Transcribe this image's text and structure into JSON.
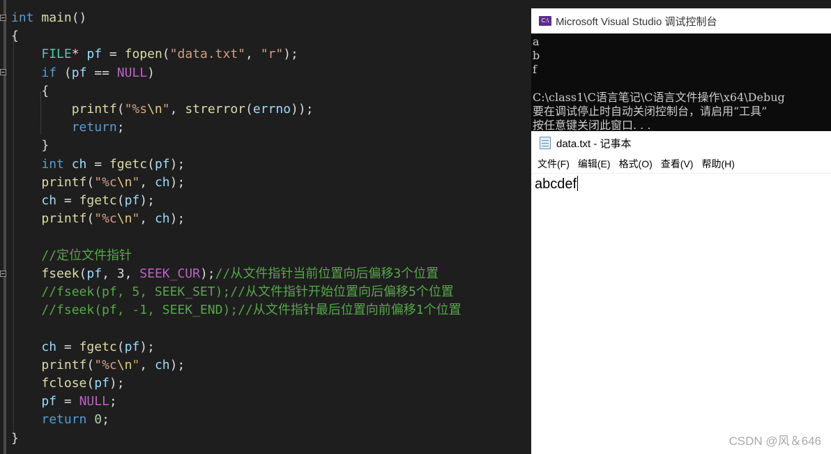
{
  "editor": {
    "lines": [
      [
        {
          "t": "int",
          "c": "kw"
        },
        {
          "t": " ",
          "c": "pl"
        },
        {
          "t": "main",
          "c": "fn"
        },
        {
          "t": "()",
          "c": "pl"
        }
      ],
      [
        {
          "t": "{",
          "c": "pl"
        }
      ],
      [
        {
          "t": "    ",
          "c": "pl"
        },
        {
          "t": "FILE",
          "c": "ty"
        },
        {
          "t": "* ",
          "c": "pl"
        },
        {
          "t": "pf",
          "c": "var"
        },
        {
          "t": " = ",
          "c": "pl"
        },
        {
          "t": "fopen",
          "c": "fn"
        },
        {
          "t": "(",
          "c": "pl"
        },
        {
          "t": "\"data.txt\"",
          "c": "st"
        },
        {
          "t": ", ",
          "c": "pl"
        },
        {
          "t": "\"r\"",
          "c": "st"
        },
        {
          "t": ");",
          "c": "pl"
        }
      ],
      [
        {
          "t": "    ",
          "c": "pl"
        },
        {
          "t": "if",
          "c": "kw"
        },
        {
          "t": " (",
          "c": "pl"
        },
        {
          "t": "pf",
          "c": "var"
        },
        {
          "t": " == ",
          "c": "pl"
        },
        {
          "t": "NULL",
          "c": "mac"
        },
        {
          "t": ")",
          "c": "pl"
        }
      ],
      [
        {
          "t": "    {",
          "c": "pl"
        }
      ],
      [
        {
          "t": "        ",
          "c": "pl"
        },
        {
          "t": "printf",
          "c": "fn"
        },
        {
          "t": "(",
          "c": "pl"
        },
        {
          "t": "\"%s",
          "c": "st"
        },
        {
          "t": "\\n",
          "c": "es"
        },
        {
          "t": "\"",
          "c": "st"
        },
        {
          "t": ", ",
          "c": "pl"
        },
        {
          "t": "strerror",
          "c": "fn"
        },
        {
          "t": "(",
          "c": "pl"
        },
        {
          "t": "errno",
          "c": "var"
        },
        {
          "t": "));",
          "c": "pl"
        }
      ],
      [
        {
          "t": "        ",
          "c": "pl"
        },
        {
          "t": "return",
          "c": "kw"
        },
        {
          "t": ";",
          "c": "pl"
        }
      ],
      [
        {
          "t": "    }",
          "c": "pl"
        }
      ],
      [
        {
          "t": "    ",
          "c": "pl"
        },
        {
          "t": "int",
          "c": "kw"
        },
        {
          "t": " ",
          "c": "pl"
        },
        {
          "t": "ch",
          "c": "var"
        },
        {
          "t": " = ",
          "c": "pl"
        },
        {
          "t": "fgetc",
          "c": "fn"
        },
        {
          "t": "(",
          "c": "pl"
        },
        {
          "t": "pf",
          "c": "var"
        },
        {
          "t": ");",
          "c": "pl"
        }
      ],
      [
        {
          "t": "    ",
          "c": "pl"
        },
        {
          "t": "printf",
          "c": "fn"
        },
        {
          "t": "(",
          "c": "pl"
        },
        {
          "t": "\"%c",
          "c": "st"
        },
        {
          "t": "\\n",
          "c": "es"
        },
        {
          "t": "\"",
          "c": "st"
        },
        {
          "t": ", ",
          "c": "pl"
        },
        {
          "t": "ch",
          "c": "var"
        },
        {
          "t": ");",
          "c": "pl"
        }
      ],
      [
        {
          "t": "    ",
          "c": "pl"
        },
        {
          "t": "ch",
          "c": "var"
        },
        {
          "t": " = ",
          "c": "pl"
        },
        {
          "t": "fgetc",
          "c": "fn"
        },
        {
          "t": "(",
          "c": "pl"
        },
        {
          "t": "pf",
          "c": "var"
        },
        {
          "t": ");",
          "c": "pl"
        }
      ],
      [
        {
          "t": "    ",
          "c": "pl"
        },
        {
          "t": "printf",
          "c": "fn"
        },
        {
          "t": "(",
          "c": "pl"
        },
        {
          "t": "\"%c",
          "c": "st"
        },
        {
          "t": "\\n",
          "c": "es"
        },
        {
          "t": "\"",
          "c": "st"
        },
        {
          "t": ", ",
          "c": "pl"
        },
        {
          "t": "ch",
          "c": "var"
        },
        {
          "t": ");",
          "c": "pl"
        }
      ],
      [],
      [
        {
          "t": "    ",
          "c": "pl"
        },
        {
          "t": "//定位文件指针",
          "c": "cm"
        }
      ],
      [
        {
          "t": "    ",
          "c": "pl"
        },
        {
          "t": "fseek",
          "c": "fn"
        },
        {
          "t": "(",
          "c": "pl"
        },
        {
          "t": "pf",
          "c": "var"
        },
        {
          "t": ", 3, ",
          "c": "pl"
        },
        {
          "t": "SEEK_CUR",
          "c": "mac"
        },
        {
          "t": ");",
          "c": "pl"
        },
        {
          "t": "//从文件指针当前位置向后偏移3个位置",
          "c": "cm"
        }
      ],
      [
        {
          "t": "    ",
          "c": "pl"
        },
        {
          "t": "//fseek(pf, 5, SEEK_SET);//从文件指针开始位置向后偏移5个位置",
          "c": "cm"
        }
      ],
      [
        {
          "t": "    ",
          "c": "pl"
        },
        {
          "t": "//fseek(pf, -1, SEEK_END);//从文件指针最后位置向前偏移1个位置",
          "c": "cm"
        }
      ],
      [],
      [
        {
          "t": "    ",
          "c": "pl"
        },
        {
          "t": "ch",
          "c": "var"
        },
        {
          "t": " = ",
          "c": "pl"
        },
        {
          "t": "fgetc",
          "c": "fn"
        },
        {
          "t": "(",
          "c": "pl"
        },
        {
          "t": "pf",
          "c": "var"
        },
        {
          "t": ");",
          "c": "pl"
        }
      ],
      [
        {
          "t": "    ",
          "c": "pl"
        },
        {
          "t": "printf",
          "c": "fn"
        },
        {
          "t": "(",
          "c": "pl"
        },
        {
          "t": "\"%c",
          "c": "st"
        },
        {
          "t": "\\n",
          "c": "es"
        },
        {
          "t": "\"",
          "c": "st"
        },
        {
          "t": ", ",
          "c": "pl"
        },
        {
          "t": "ch",
          "c": "var"
        },
        {
          "t": ");",
          "c": "pl"
        }
      ],
      [
        {
          "t": "    ",
          "c": "pl"
        },
        {
          "t": "fclose",
          "c": "fn"
        },
        {
          "t": "(",
          "c": "pl"
        },
        {
          "t": "pf",
          "c": "var"
        },
        {
          "t": ");",
          "c": "pl"
        }
      ],
      [
        {
          "t": "    ",
          "c": "pl"
        },
        {
          "t": "pf",
          "c": "var"
        },
        {
          "t": " = ",
          "c": "pl"
        },
        {
          "t": "NULL",
          "c": "mac"
        },
        {
          "t": ";",
          "c": "pl"
        }
      ],
      [
        {
          "t": "    ",
          "c": "pl"
        },
        {
          "t": "return",
          "c": "kw"
        },
        {
          "t": " ",
          "c": "pl"
        },
        {
          "t": "0",
          "c": "num"
        },
        {
          "t": ";",
          "c": "pl"
        }
      ],
      [
        {
          "t": "}",
          "c": "pl"
        }
      ]
    ]
  },
  "console": {
    "icon_label": "C:\\",
    "title": "Microsoft Visual Studio 调试控制台",
    "output": "a\nb\nf\n\nC:\\class1\\C语言笔记\\C语言文件操作\\x64\\Debug\n要在调试停止时自动关闭控制台，请启用“工具”\n按任意键关闭此窗口. . ."
  },
  "notepad": {
    "title": "data.txt - 记事本",
    "menu": [
      "文件(F)",
      "编辑(E)",
      "格式(O)",
      "查看(V)",
      "帮助(H)"
    ],
    "content": "abcdef"
  },
  "watermark": "CSDN @风＆646"
}
